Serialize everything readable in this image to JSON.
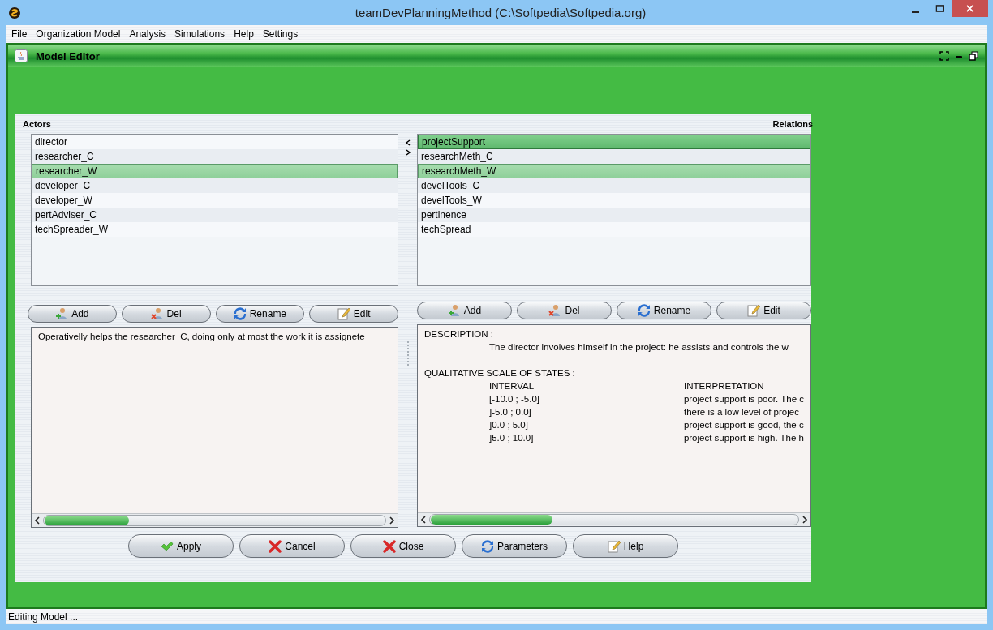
{
  "window": {
    "title": "teamDevPlanningMethod (C:\\Softpedia\\Softpedia.org)"
  },
  "menu": [
    "File",
    "Organization Model",
    "Analysis",
    "Simulations",
    "Help",
    "Settings"
  ],
  "internal_frame": {
    "title": "Model Editor"
  },
  "actors": {
    "label": "Actors",
    "items": [
      {
        "label": "director",
        "selected": false
      },
      {
        "label": "researcher_C",
        "selected": false
      },
      {
        "label": "researcher_W",
        "selected": true
      },
      {
        "label": "developer_C",
        "selected": false
      },
      {
        "label": "developer_W",
        "selected": false
      },
      {
        "label": "pertAdviser_C",
        "selected": false
      },
      {
        "label": "techSpreader_W",
        "selected": false
      }
    ],
    "buttons": [
      {
        "label": "Add",
        "kind": "add"
      },
      {
        "label": "Del",
        "kind": "del"
      },
      {
        "label": "Rename",
        "kind": "rename"
      },
      {
        "label": "Edit",
        "kind": "edit"
      }
    ],
    "description": "Operativelly helps the researcher_C, doing only at most the work it is assignete"
  },
  "relations": {
    "label": "Relations",
    "items": [
      {
        "label": "projectSupport",
        "selected": true,
        "focused": true
      },
      {
        "label": "researchMeth_C",
        "selected": false,
        "focused": false
      },
      {
        "label": "researchMeth_W",
        "selected": true,
        "focused": false
      },
      {
        "label": "develTools_C",
        "selected": false,
        "focused": false
      },
      {
        "label": "develTools_W",
        "selected": false,
        "focused": false
      },
      {
        "label": "pertinence",
        "selected": false,
        "focused": false
      },
      {
        "label": "techSpread",
        "selected": false,
        "focused": false
      }
    ],
    "buttons": [
      {
        "label": "Add",
        "kind": "add"
      },
      {
        "label": "Del",
        "kind": "del"
      },
      {
        "label": "Rename",
        "kind": "rename"
      },
      {
        "label": "Edit",
        "kind": "edit"
      }
    ],
    "description": {
      "heading": "DESCRIPTION :",
      "text": "The director involves himself in the project: he assists and controls the w",
      "scale_heading": "QUALITATIVE SCALE OF STATES :",
      "columns": [
        "INTERVAL",
        "INTERPRETATION"
      ],
      "rows": [
        [
          "[-10.0 ; -5.0]",
          "project support is poor. The c"
        ],
        [
          "]-5.0 ; 0.0]",
          "there is a low level of projec"
        ],
        [
          "]0.0 ; 5.0]",
          "project support is good, the c"
        ],
        [
          "]5.0 ; 10.0]",
          "project support is high. The h"
        ]
      ]
    }
  },
  "buttons": [
    {
      "label": "Apply",
      "kind": "check"
    },
    {
      "label": "Cancel",
      "kind": "cross"
    },
    {
      "label": "Close",
      "kind": "cross"
    },
    {
      "label": "Parameters",
      "kind": "rename"
    },
    {
      "label": "Help",
      "kind": "edit"
    }
  ],
  "status_bar": "Editing Model ..."
}
